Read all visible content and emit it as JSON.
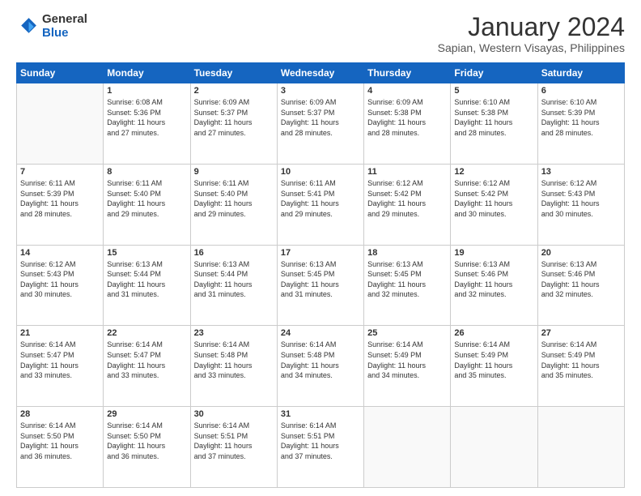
{
  "header": {
    "logo_general": "General",
    "logo_blue": "Blue",
    "title": "January 2024",
    "subtitle": "Sapian, Western Visayas, Philippines"
  },
  "columns": [
    "Sunday",
    "Monday",
    "Tuesday",
    "Wednesday",
    "Thursday",
    "Friday",
    "Saturday"
  ],
  "weeks": [
    [
      {
        "num": "",
        "empty": true
      },
      {
        "num": "1",
        "sunrise": "Sunrise: 6:08 AM",
        "sunset": "Sunset: 5:36 PM",
        "daylight": "Daylight: 11 hours and 27 minutes."
      },
      {
        "num": "2",
        "sunrise": "Sunrise: 6:09 AM",
        "sunset": "Sunset: 5:37 PM",
        "daylight": "Daylight: 11 hours and 27 minutes."
      },
      {
        "num": "3",
        "sunrise": "Sunrise: 6:09 AM",
        "sunset": "Sunset: 5:37 PM",
        "daylight": "Daylight: 11 hours and 28 minutes."
      },
      {
        "num": "4",
        "sunrise": "Sunrise: 6:09 AM",
        "sunset": "Sunset: 5:38 PM",
        "daylight": "Daylight: 11 hours and 28 minutes."
      },
      {
        "num": "5",
        "sunrise": "Sunrise: 6:10 AM",
        "sunset": "Sunset: 5:38 PM",
        "daylight": "Daylight: 11 hours and 28 minutes."
      },
      {
        "num": "6",
        "sunrise": "Sunrise: 6:10 AM",
        "sunset": "Sunset: 5:39 PM",
        "daylight": "Daylight: 11 hours and 28 minutes."
      }
    ],
    [
      {
        "num": "7",
        "sunrise": "Sunrise: 6:11 AM",
        "sunset": "Sunset: 5:39 PM",
        "daylight": "Daylight: 11 hours and 28 minutes."
      },
      {
        "num": "8",
        "sunrise": "Sunrise: 6:11 AM",
        "sunset": "Sunset: 5:40 PM",
        "daylight": "Daylight: 11 hours and 29 minutes."
      },
      {
        "num": "9",
        "sunrise": "Sunrise: 6:11 AM",
        "sunset": "Sunset: 5:40 PM",
        "daylight": "Daylight: 11 hours and 29 minutes."
      },
      {
        "num": "10",
        "sunrise": "Sunrise: 6:11 AM",
        "sunset": "Sunset: 5:41 PM",
        "daylight": "Daylight: 11 hours and 29 minutes."
      },
      {
        "num": "11",
        "sunrise": "Sunrise: 6:12 AM",
        "sunset": "Sunset: 5:42 PM",
        "daylight": "Daylight: 11 hours and 29 minutes."
      },
      {
        "num": "12",
        "sunrise": "Sunrise: 6:12 AM",
        "sunset": "Sunset: 5:42 PM",
        "daylight": "Daylight: 11 hours and 30 minutes."
      },
      {
        "num": "13",
        "sunrise": "Sunrise: 6:12 AM",
        "sunset": "Sunset: 5:43 PM",
        "daylight": "Daylight: 11 hours and 30 minutes."
      }
    ],
    [
      {
        "num": "14",
        "sunrise": "Sunrise: 6:12 AM",
        "sunset": "Sunset: 5:43 PM",
        "daylight": "Daylight: 11 hours and 30 minutes."
      },
      {
        "num": "15",
        "sunrise": "Sunrise: 6:13 AM",
        "sunset": "Sunset: 5:44 PM",
        "daylight": "Daylight: 11 hours and 31 minutes."
      },
      {
        "num": "16",
        "sunrise": "Sunrise: 6:13 AM",
        "sunset": "Sunset: 5:44 PM",
        "daylight": "Daylight: 11 hours and 31 minutes."
      },
      {
        "num": "17",
        "sunrise": "Sunrise: 6:13 AM",
        "sunset": "Sunset: 5:45 PM",
        "daylight": "Daylight: 11 hours and 31 minutes."
      },
      {
        "num": "18",
        "sunrise": "Sunrise: 6:13 AM",
        "sunset": "Sunset: 5:45 PM",
        "daylight": "Daylight: 11 hours and 32 minutes."
      },
      {
        "num": "19",
        "sunrise": "Sunrise: 6:13 AM",
        "sunset": "Sunset: 5:46 PM",
        "daylight": "Daylight: 11 hours and 32 minutes."
      },
      {
        "num": "20",
        "sunrise": "Sunrise: 6:13 AM",
        "sunset": "Sunset: 5:46 PM",
        "daylight": "Daylight: 11 hours and 32 minutes."
      }
    ],
    [
      {
        "num": "21",
        "sunrise": "Sunrise: 6:14 AM",
        "sunset": "Sunset: 5:47 PM",
        "daylight": "Daylight: 11 hours and 33 minutes."
      },
      {
        "num": "22",
        "sunrise": "Sunrise: 6:14 AM",
        "sunset": "Sunset: 5:47 PM",
        "daylight": "Daylight: 11 hours and 33 minutes."
      },
      {
        "num": "23",
        "sunrise": "Sunrise: 6:14 AM",
        "sunset": "Sunset: 5:48 PM",
        "daylight": "Daylight: 11 hours and 33 minutes."
      },
      {
        "num": "24",
        "sunrise": "Sunrise: 6:14 AM",
        "sunset": "Sunset: 5:48 PM",
        "daylight": "Daylight: 11 hours and 34 minutes."
      },
      {
        "num": "25",
        "sunrise": "Sunrise: 6:14 AM",
        "sunset": "Sunset: 5:49 PM",
        "daylight": "Daylight: 11 hours and 34 minutes."
      },
      {
        "num": "26",
        "sunrise": "Sunrise: 6:14 AM",
        "sunset": "Sunset: 5:49 PM",
        "daylight": "Daylight: 11 hours and 35 minutes."
      },
      {
        "num": "27",
        "sunrise": "Sunrise: 6:14 AM",
        "sunset": "Sunset: 5:49 PM",
        "daylight": "Daylight: 11 hours and 35 minutes."
      }
    ],
    [
      {
        "num": "28",
        "sunrise": "Sunrise: 6:14 AM",
        "sunset": "Sunset: 5:50 PM",
        "daylight": "Daylight: 11 hours and 36 minutes."
      },
      {
        "num": "29",
        "sunrise": "Sunrise: 6:14 AM",
        "sunset": "Sunset: 5:50 PM",
        "daylight": "Daylight: 11 hours and 36 minutes."
      },
      {
        "num": "30",
        "sunrise": "Sunrise: 6:14 AM",
        "sunset": "Sunset: 5:51 PM",
        "daylight": "Daylight: 11 hours and 37 minutes."
      },
      {
        "num": "31",
        "sunrise": "Sunrise: 6:14 AM",
        "sunset": "Sunset: 5:51 PM",
        "daylight": "Daylight: 11 hours and 37 minutes."
      },
      {
        "num": "",
        "empty": true
      },
      {
        "num": "",
        "empty": true
      },
      {
        "num": "",
        "empty": true
      }
    ]
  ]
}
